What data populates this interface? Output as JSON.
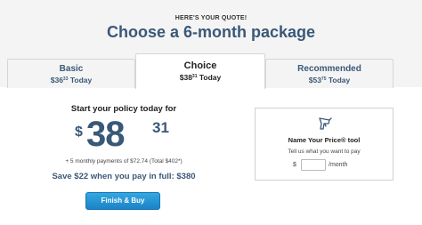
{
  "header": {
    "eyebrow": "HERE'S YOUR QUOTE!",
    "title": "Choose a 6-month package"
  },
  "tabs": [
    {
      "name": "Basic",
      "price_prefix": "$36",
      "price_cents": "33",
      "price_suffix": " Today",
      "selected": false
    },
    {
      "name": "Choice",
      "price_prefix": "$38",
      "price_cents": "31",
      "price_suffix": " Today",
      "selected": true
    },
    {
      "name": "Recommended",
      "price_prefix": "$53",
      "price_cents": "75",
      "price_suffix": " Today",
      "selected": false
    }
  ],
  "main": {
    "start_text": "Start your policy today for",
    "price_dollar_sign": "$",
    "price_dollars": "38",
    "price_cents": "31",
    "payments_text": "+ 5 monthly payments of $72.74 (Total $402*)",
    "save_text": "Save $22 when you pay in full: $380",
    "finish_button": "Finish & Buy"
  },
  "name_your_price": {
    "icon": "price-gun-icon",
    "title": "Name Your Price® tool",
    "subtitle": "Tell us what you want to pay",
    "currency": "$",
    "input_value": "",
    "unit": "/month"
  },
  "colors": {
    "accent": "#3a5878",
    "button": "#1b83c6",
    "header_bg": "#f4f4f4"
  }
}
